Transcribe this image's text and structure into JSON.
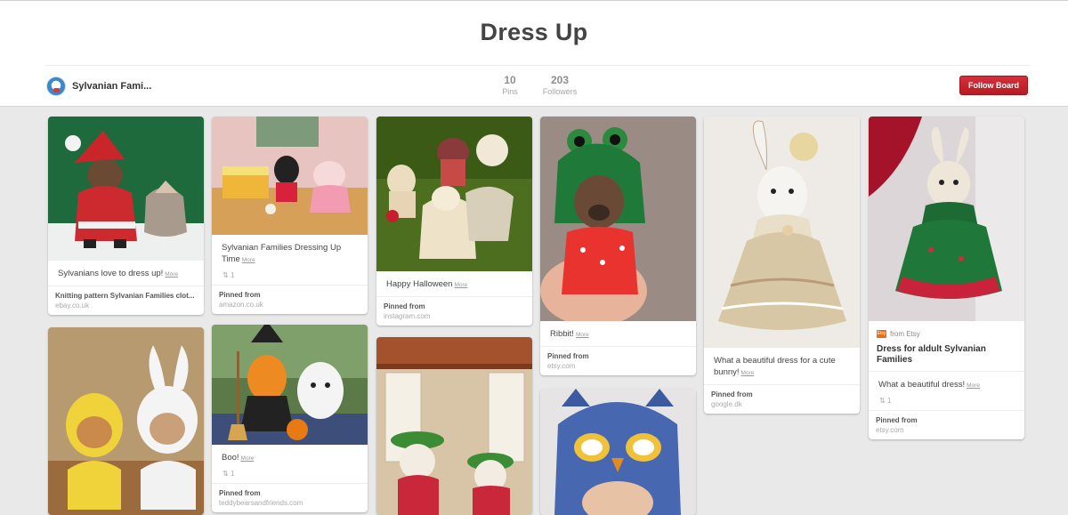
{
  "board": {
    "title": "Dress Up",
    "owner_name": "Sylvanian Fami...",
    "pins_count": "10",
    "pins_label": "Pins",
    "followers_count": "203",
    "followers_label": "Followers",
    "follow_label": "Follow Board"
  },
  "pins": [
    {
      "description": "Sylvanians love to dress up!",
      "more": "More",
      "attrib_title": "Knitting pattern Sylvanian Families clot...",
      "attrib_source": "ebay.co.uk"
    },
    {
      "description": "Sylvanian Families Dressing Up Time",
      "more": "More",
      "repins": "1",
      "attrib_title": "Pinned from",
      "attrib_source": "amazon.co.uk"
    },
    {
      "description": "Happy Halloween",
      "more": "More",
      "attrib_title": "Pinned from",
      "attrib_source": "instagram.com"
    },
    {
      "description": "Ribbit!",
      "more": "More",
      "attrib_title": "Pinned from",
      "attrib_source": "etsy.com"
    },
    {
      "description": "What a beautiful dress for a cute bunny!",
      "more": "More",
      "attrib_title": "Pinned from",
      "attrib_source": "google.dk"
    },
    {
      "from": "from Etsy",
      "title": "Dress for aldult Sylvanian Families",
      "description": "What a beautiful dress!",
      "more": "More",
      "repins": "1",
      "attrib_title": "Pinned from",
      "attrib_source": "etsy.com"
    },
    {
      "description": "Boo!",
      "more": "More",
      "repins": "1",
      "attrib_title": "Pinned from",
      "attrib_source": "teddybearsandfriends.com"
    }
  ]
}
